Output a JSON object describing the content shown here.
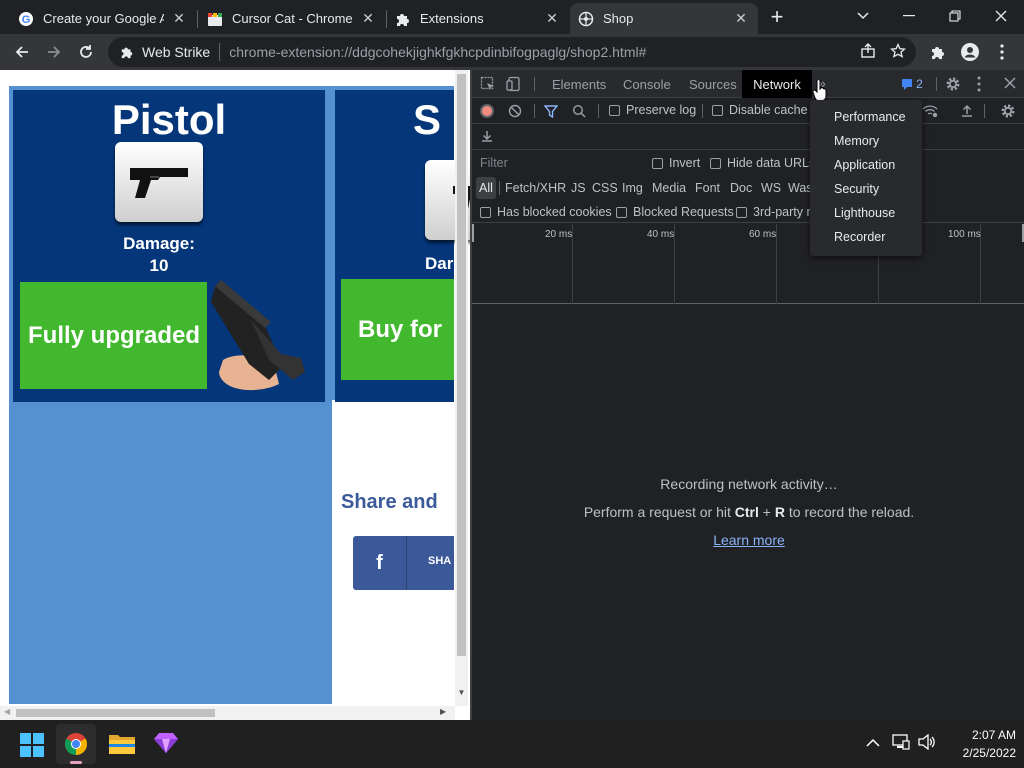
{
  "tabs": [
    {
      "label": "Create your Google Ac",
      "icon": "google-icon",
      "active": false
    },
    {
      "label": "Cursor Cat - Chrome W",
      "icon": "webstore-icon",
      "active": false
    },
    {
      "label": "Extensions",
      "icon": "puzzle-icon",
      "active": false
    },
    {
      "label": "Shop",
      "icon": "shop-favicon-icon",
      "active": true
    }
  ],
  "toolbar": {
    "site_name": "Web Strike",
    "url": "chrome-extension://ddgcohekjighkfgkhcpdinbifogpaglg/shop2.html#"
  },
  "page": {
    "card1": {
      "title": "Pistol",
      "damage_label": "Damage:",
      "damage_value": "10",
      "button": "Fully upgraded"
    },
    "card2": {
      "title": "S",
      "damage_label": "Dar",
      "button": "Buy for"
    },
    "share_text": "Share and",
    "share_btn_label": "SHA",
    "share_btn_icon": "f"
  },
  "devtools": {
    "tabs": [
      "Elements",
      "Console",
      "Sources",
      "Network"
    ],
    "active_tab": "Network",
    "issues_count": "2",
    "preserve_log": "Preserve log",
    "disable_cache": "Disable cache",
    "filter_placeholder": "Filter",
    "invert": "Invert",
    "hide_data_urls": "Hide data URLs",
    "types": [
      "All",
      "Fetch/XHR",
      "JS",
      "CSS",
      "Img",
      "Media",
      "Font",
      "Doc",
      "WS",
      "Was"
    ],
    "has_blocked_cookies": "Has blocked cookies",
    "blocked_requests": "Blocked Requests",
    "third_party": "3rd-party r",
    "timeline_ticks": [
      "20 ms",
      "40 ms",
      "60 ms",
      "100 ms"
    ],
    "recording_text": "Recording network activity…",
    "hint_prefix": "Perform a request or hit ",
    "hint_key1": "Ctrl",
    "hint_plus": " + ",
    "hint_key2": "R",
    "hint_suffix": " to record the reload.",
    "learn_more": "Learn more",
    "overflow_menu": [
      "Performance",
      "Memory",
      "Application",
      "Security",
      "Lighthouse",
      "Recorder"
    ]
  },
  "taskbar": {
    "time": "2:07 AM",
    "date": "2/25/2022"
  },
  "colors": {
    "accent_blue": "#8ab4f8",
    "record_red": "#f28b82",
    "green_button": "#41b82e",
    "card_blue": "#05367a",
    "page_bg_blue": "#5590d0"
  }
}
